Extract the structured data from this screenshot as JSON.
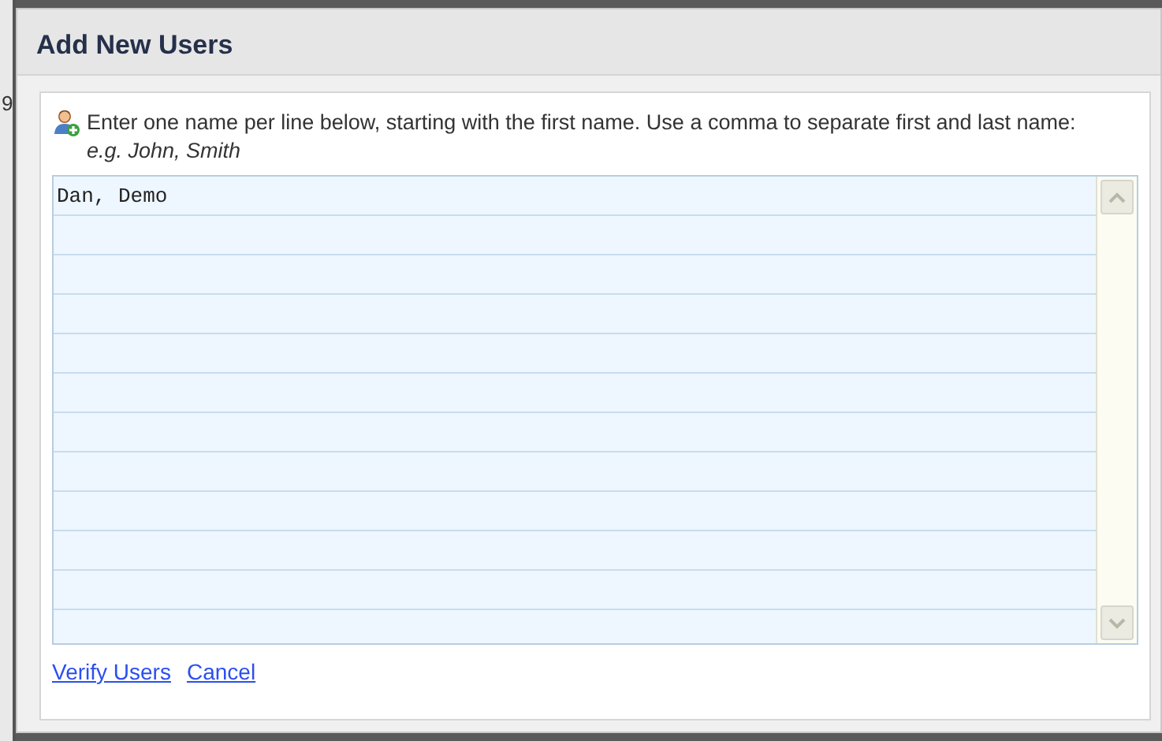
{
  "background": {
    "fragment": "9"
  },
  "dialog": {
    "title": "Add New Users",
    "instructions": "Enter one name per line below, starting with the first name. Use a comma to separate first and last name: *e.g. John, Smith*",
    "names_field": {
      "value": "Dan, Demo"
    },
    "links": [
      {
        "label": "Verify Users"
      },
      {
        "label": "Cancel"
      }
    ]
  }
}
